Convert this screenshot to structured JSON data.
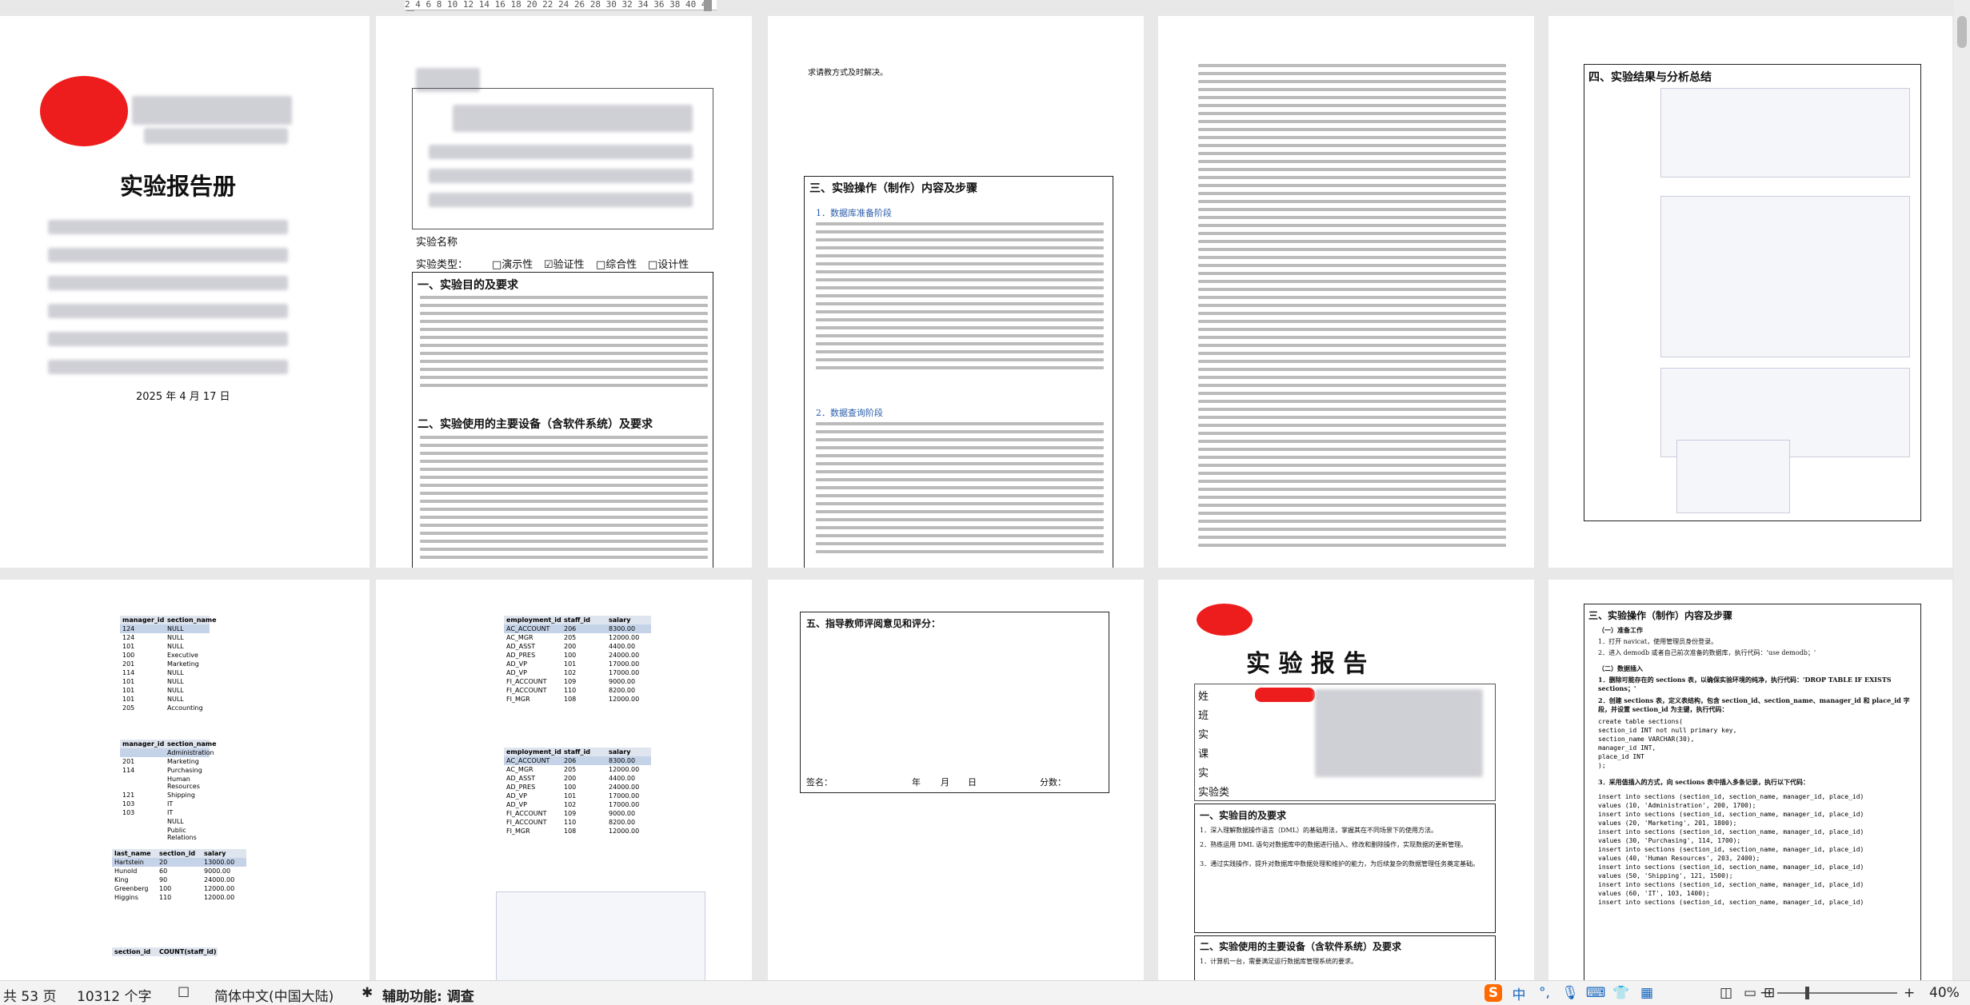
{
  "ruler": {
    "ticks": "2 4 6 8 10 12 14 16 18 20 22 24 26 28 30 32 34 36 38 40 42"
  },
  "page1": {
    "title": "实验报告册",
    "date": "2025 年 4 月 17 日"
  },
  "page2": {
    "course_name_label": "实验名称",
    "type_label": "实验类型：",
    "types": [
      "□演示性",
      "☑验证性",
      "□综合性",
      "□设计性"
    ],
    "sec1": "一、实验目的及要求",
    "sec2": "二、实验使用的主要设备（含软件系统）及要求"
  },
  "page3": {
    "tail": "求请教方式及时解决。",
    "sec3": "三、实验操作（制作）内容及步骤",
    "sub1": "1．数据库准备阶段",
    "sub2": "2．数据查询阶段"
  },
  "page5": {
    "title": "四、实验结果与分析总结"
  },
  "page6": {
    "t1_headers": [
      "manager_id",
      "section_name"
    ],
    "t1_rows": [
      [
        "124",
        "NULL"
      ],
      [
        "124",
        "NULL"
      ],
      [
        "101",
        "NULL"
      ],
      [
        "100",
        "Executive"
      ],
      [
        "201",
        "Marketing"
      ],
      [
        "114",
        "NULL"
      ],
      [
        "101",
        "NULL"
      ],
      [
        "101",
        "NULL"
      ],
      [
        "101",
        "NULL"
      ],
      [
        "205",
        "Accounting"
      ]
    ],
    "t2_headers": [
      "manager_id",
      "section_name"
    ],
    "t2_rows": [
      [
        "",
        "Administration"
      ],
      [
        "201",
        "Marketing"
      ],
      [
        "114",
        "Purchasing"
      ],
      [
        "",
        "Human Resources"
      ],
      [
        "121",
        "Shipping"
      ],
      [
        "103",
        "IT"
      ],
      [
        "103",
        "IT"
      ],
      [
        "",
        "NULL"
      ],
      [
        "",
        "Public Relations"
      ]
    ],
    "t3_headers": [
      "last_name",
      "section_id",
      "salary"
    ],
    "t3_rows": [
      [
        "Hartstein",
        "20",
        "13000.00"
      ],
      [
        "Hunold",
        "60",
        "9000.00"
      ],
      [
        "King",
        "90",
        "24000.00"
      ],
      [
        "Greenberg",
        "100",
        "12000.00"
      ],
      [
        "Higgins",
        "110",
        "12000.00"
      ]
    ],
    "t4_headers": [
      "section_id",
      "COUNT(staff_id)"
    ]
  },
  "page7": {
    "headers": [
      "employment_id",
      "staff_id",
      "salary"
    ],
    "rows": [
      [
        "AC_ACCOUNT",
        "206",
        "8300.00"
      ],
      [
        "AC_MGR",
        "205",
        "12000.00"
      ],
      [
        "AD_ASST",
        "200",
        "4400.00"
      ],
      [
        "AD_PRES",
        "100",
        "24000.00"
      ],
      [
        "AD_VP",
        "101",
        "17000.00"
      ],
      [
        "AD_VP",
        "102",
        "17000.00"
      ],
      [
        "FI_ACCOUNT",
        "109",
        "9000.00"
      ],
      [
        "FI_ACCOUNT",
        "110",
        "8200.00"
      ],
      [
        "FI_MGR",
        "108",
        "12000.00"
      ]
    ]
  },
  "page8": {
    "title": "五、指导教师评阅意见和评分：",
    "sign": "签名：",
    "year": "年",
    "month": "月",
    "day": "日",
    "score": "分数："
  },
  "page9": {
    "title": "实  验  报  告",
    "labels": [
      "姓",
      "班",
      "实",
      "课",
      "实",
      "实验类"
    ],
    "sec1": "一、实验目的及要求",
    "items": [
      "1．深入理解数据操作语言（DML）的基础用法，掌握其在不同场景下的使用方法。",
      "2．熟练运用 DML 语句对数据库中的数据进行插入、修改和删除操作，实现数据的更新管理。",
      "3．通过实践操作，提升对数据库中数据处理和维护的能力，为后续复杂的数据管理任务奠定基础。"
    ],
    "sec2": "二、实验使用的主要设备（含软件系统）及要求",
    "foot": "1．计算机一台，需要满足运行数据库管理系统的要求。"
  },
  "page10": {
    "sec3": "三、实验操作（制作）内容及步骤",
    "s1": "（一）准备工作",
    "s1a": "1．打开 navicat，使用管理员身份登录。",
    "s1b": "2．进入 demodb 或者自己前次准备的数据库，执行代码：'use demodb；'",
    "s2": "（二）数据插入",
    "s2a": "1．删除可能存在的 sections 表，以确保实验环境的纯净，执行代码：'DROP TABLE IF EXISTS sections；'",
    "s2b": "2．创建 sections 表，定义表结构，包含 section_id、section_name、manager_id 和 place_id 字段，并设置 section_id 为主键，执行代码：",
    "code": [
      "create table sections(",
      "  section_id   INT        not null primary key,",
      "  section_name VARCHAR(30),",
      "  manager_id   INT,",
      "  place_id     INT",
      ");"
    ],
    "s2c": "3．采用值插入的方式，向 sections 表中插入多条记录，执行以下代码：",
    "inserts": [
      "insert into sections (section_id, section_name, manager_id, place_id)",
      "values (10, 'Administration', 200, 1700);",
      "insert into sections (section_id, section_name, manager_id, place_id)",
      "values (20, 'Marketing', 201, 1800);",
      "insert into sections (section_id, section_name, manager_id, place_id)",
      "values (30, 'Purchasing', 114, 1700);",
      "insert into sections (section_id, section_name, manager_id, place_id)",
      "values (40, 'Human Resources', 203, 2400);",
      "insert into sections (section_id, section_name, manager_id, place_id)",
      "values (50, 'Shipping', 121, 1500);",
      "insert into sections (section_id, section_name, manager_id, place_id)",
      "values (60, 'IT', 103, 1400);",
      "insert into sections (section_id, section_name, manager_id, place_id)"
    ]
  },
  "status": {
    "pages": "共 53 页",
    "words": "10312 个字",
    "lang": "简体中文(中国大陆)",
    "access": "辅助功能: 调查",
    "zoom": "40%",
    "ime_lang": "中",
    "minus": "−",
    "plus": "+"
  }
}
